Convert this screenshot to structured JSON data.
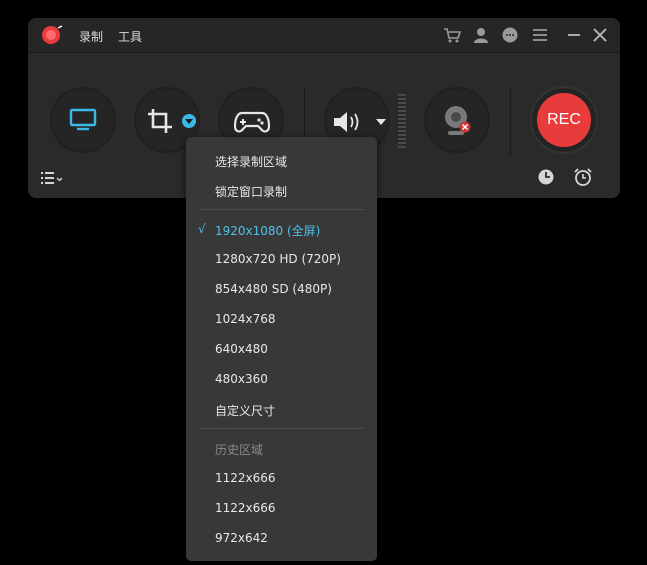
{
  "menu": {
    "record": "录制",
    "tools": "工具"
  },
  "record_button": {
    "label": "REC",
    "color": "#e83b3b"
  },
  "accent_color": "#3ab9e6",
  "titlebar_icons": [
    "cart-icon",
    "user-icon",
    "chat-icon",
    "menu-icon",
    "minimize-icon",
    "close-icon"
  ],
  "dropdown": {
    "items_top": [
      "选择录制区域",
      "锁定窗口录制"
    ],
    "resolutions": [
      {
        "label": "1920x1080 (全屏)",
        "checked": true
      },
      {
        "label": "1280x720 HD (720P)",
        "checked": false
      },
      {
        "label": "854x480 SD (480P)",
        "checked": false
      },
      {
        "label": "1024x768",
        "checked": false
      },
      {
        "label": "640x480",
        "checked": false
      },
      {
        "label": "480x360",
        "checked": false
      },
      {
        "label": "自定义尺寸",
        "checked": false
      }
    ],
    "history_header": "历史区域",
    "history": [
      "1122x666",
      "1122x666",
      "972x642"
    ],
    "check_mark": "√"
  }
}
